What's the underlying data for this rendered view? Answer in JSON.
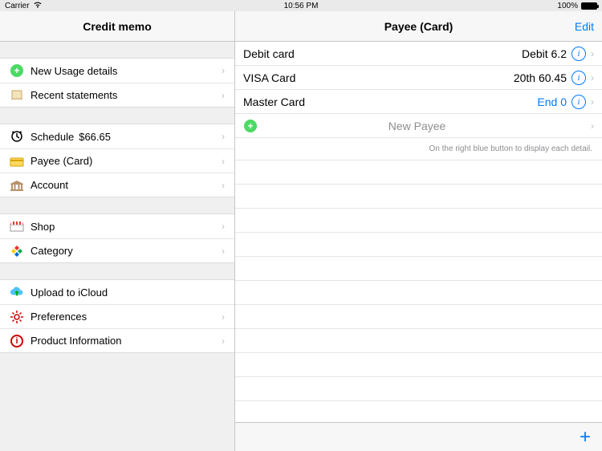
{
  "status": {
    "carrier": "Carrier",
    "time": "10:56 PM",
    "battery": "100%"
  },
  "left": {
    "title": "Credit memo",
    "g1": [
      {
        "label": "New Usage details"
      },
      {
        "label": "Recent statements"
      }
    ],
    "g2": [
      {
        "label": "Schedule",
        "value": "$66.65"
      },
      {
        "label": "Payee (Card)"
      },
      {
        "label": "Account"
      }
    ],
    "g3": [
      {
        "label": "Shop"
      },
      {
        "label": "Category"
      }
    ],
    "g4": [
      {
        "label": "Upload to iCloud"
      },
      {
        "label": "Preferences"
      },
      {
        "label": "Product Information"
      }
    ]
  },
  "right": {
    "title": "Payee (Card)",
    "edit": "Edit",
    "rows": [
      {
        "label": "Debit card",
        "value": "Debit 6.2"
      },
      {
        "label": "VISA Card",
        "value": "20th 60.45"
      },
      {
        "label": "Master Card",
        "value": "End 0"
      }
    ],
    "new_payee": "New Payee",
    "hint": "On the right blue button to display each detail.",
    "plus": "+"
  }
}
